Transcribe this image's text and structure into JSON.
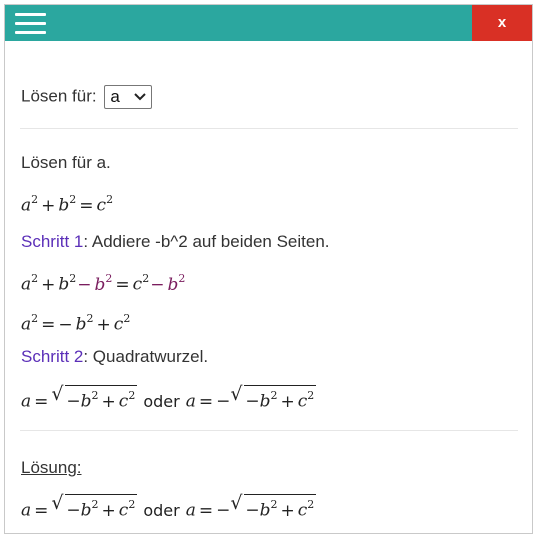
{
  "header": {
    "menu_icon": "hamburger-icon",
    "close_label": "x"
  },
  "solve_for": {
    "label": "Lösen für:",
    "selected": "a"
  },
  "intro": "Lösen für a.",
  "step1": {
    "label": "Schritt 1",
    "text": ": Addiere -b^2 auf beiden Seiten."
  },
  "step2": {
    "label": "Schritt 2",
    "text": ": Quadratwurzel."
  },
  "math": {
    "equation": "a^2 + b^2 = c^2",
    "step1_result": "a^2 + b^2 - b^2 = c^2 - b^2",
    "step1_simplified": "a^2 = -b^2 + c^2",
    "roots": "a = sqrt(-b^2 + c^2) oder a = -sqrt(-b^2 + c^2)",
    "or_word": "oder"
  },
  "solution": {
    "label": "Lösung:",
    "result": "a = sqrt(-b^2 + c^2) oder a = -sqrt(-b^2 + c^2)"
  },
  "colors": {
    "header": "#2ba79f",
    "close": "#d93025",
    "step_link": "#5b2fb8",
    "highlight": "#7a1d5e"
  }
}
